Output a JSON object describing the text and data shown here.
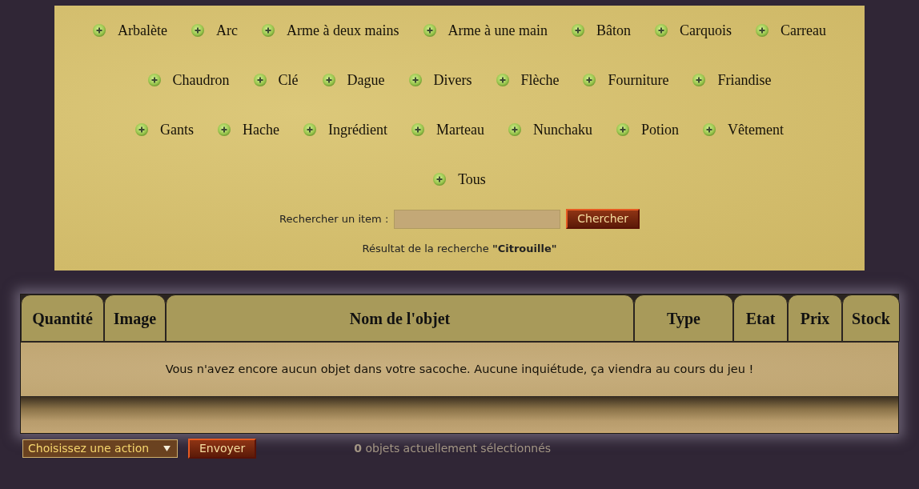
{
  "categories": [
    {
      "items": [
        "Arbalète",
        "Arc",
        "Arme à deux mains",
        "Arme à une main",
        "Bâton",
        "Carquois",
        "Carreau"
      ]
    },
    {
      "items": [
        "Chaudron",
        "Clé",
        "Dague",
        "Divers",
        "Flèche",
        "Fourniture",
        "Friandise"
      ]
    },
    {
      "items": [
        "Gants",
        "Hache",
        "Ingrédient",
        "Marteau",
        "Nunchaku",
        "Potion",
        "Vêtement"
      ]
    },
    {
      "items": [
        "Tous"
      ]
    }
  ],
  "search": {
    "label": "Rechercher un item :",
    "button": "Chercher"
  },
  "search_result": "Résultat de la recherche **\"Citrouille\"**",
  "table": {
    "columns": [
      "Quantité",
      "Image",
      "Nom de l'objet",
      "Type",
      "Etat",
      "Prix",
      "Stock"
    ],
    "empty_message": "Vous n'avez encore aucun objet dans votre sacoche. Aucune inquiétude, ça viendra au cours du jeu !"
  },
  "actions": {
    "select": "Choisissez une action",
    "button": "Envoyer",
    "selection": "**0** objets actuellement sélectionnés"
  }
}
